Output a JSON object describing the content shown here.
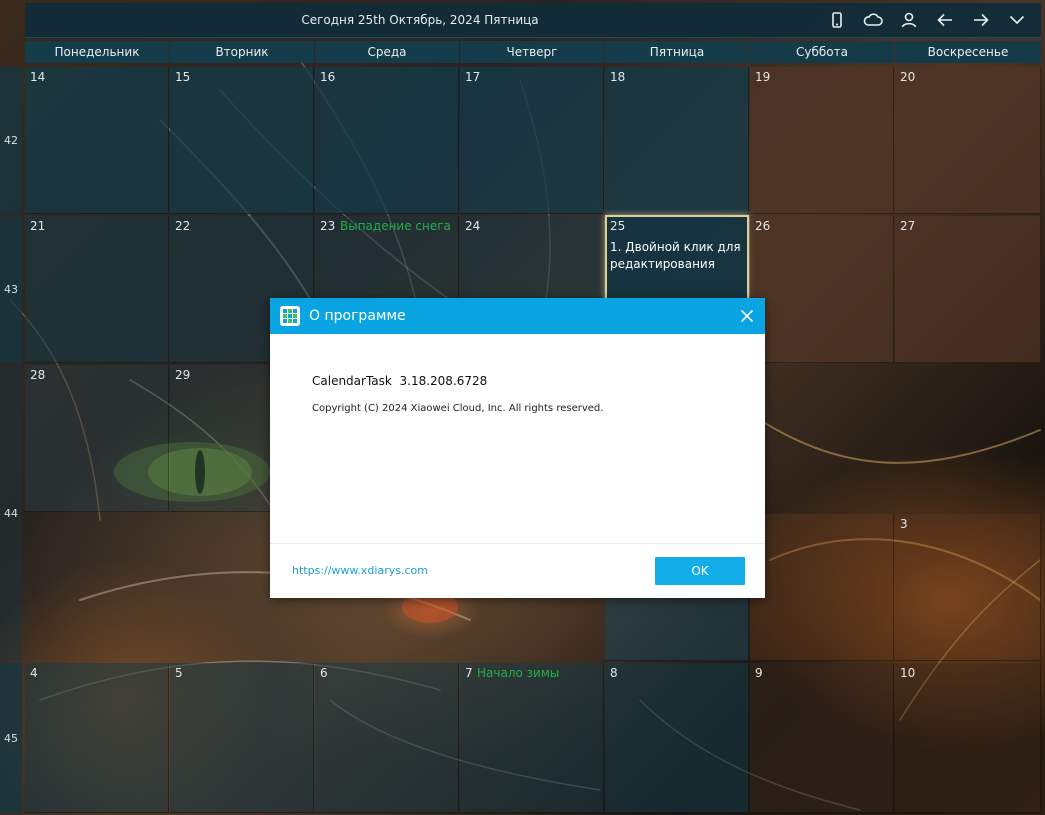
{
  "header": {
    "title": "Сегодня 25th Октябрь, 2024 Пятница",
    "icons": [
      "phone-icon",
      "cloud-icon",
      "user-icon",
      "arrow-left-icon",
      "arrow-right-icon",
      "chevron-down-icon"
    ]
  },
  "weekdays": [
    "Понедельник",
    "Вторник",
    "Среда",
    "Четверг",
    "Пятница",
    "Суббота",
    "Воскресенье"
  ],
  "weeks": [
    {
      "number": "42",
      "days": [
        "14",
        "15",
        "16",
        "17",
        "18",
        "19",
        "20"
      ]
    },
    {
      "number": "43",
      "days": [
        "21",
        "22",
        "23",
        "24",
        "25",
        "26",
        "27"
      ]
    },
    {
      "number": "44",
      "days": [
        "28",
        "29",
        "",
        "",
        "",
        "",
        "3"
      ]
    },
    {
      "number": "45",
      "days": [
        "4",
        "5",
        "6",
        "7",
        "8",
        "9",
        "10"
      ]
    }
  ],
  "events": {
    "w1d2": "Выпадение снега",
    "w3d3": "Начало зимы"
  },
  "today_task": "1. Двойной клик для редактирования",
  "dialog": {
    "title": "О программе",
    "app_name": "CalendarTask",
    "version": "3.18.208.6728",
    "copyright": "Copyright (C) 2024 Xiaowei Cloud, Inc. All rights reserved.",
    "link": "https://www.xdiarys.com",
    "ok_label": "OK"
  },
  "colors": {
    "dialog_header": "#0aa4e3",
    "ok_button": "#13aee8",
    "event_text": "#1fb04a",
    "weekday_cell": "#143a48",
    "weekend_cell": "#503426"
  }
}
